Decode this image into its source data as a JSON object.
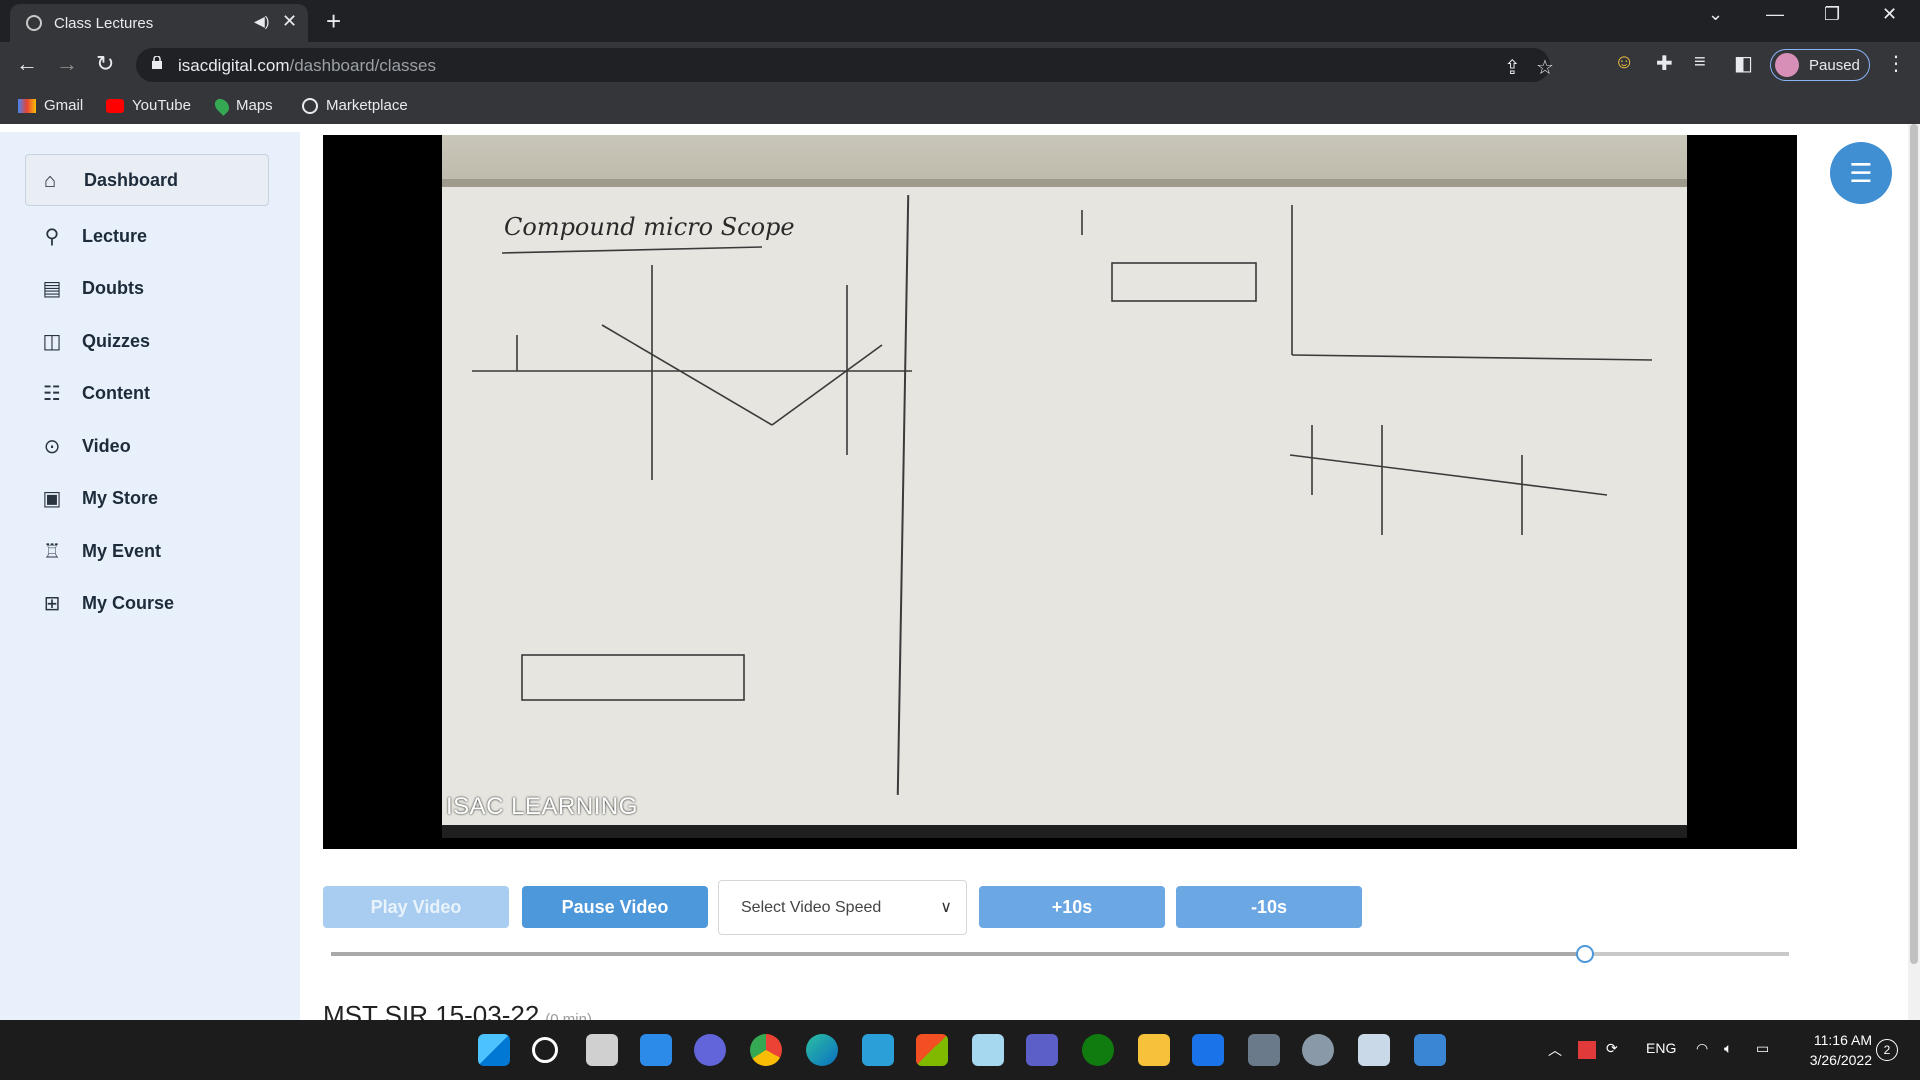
{
  "browser": {
    "tab_title": "Class Lectures",
    "url_host": "isacdigital.com",
    "url_path": "/dashboard/classes",
    "profile_label": "Paused",
    "bookmarks": [
      "Gmail",
      "YouTube",
      "Maps",
      "Marketplace"
    ]
  },
  "sidebar": {
    "dashboard_label": "Dashboard",
    "items": [
      {
        "label": "Lecture",
        "icon": "lecture-icon"
      },
      {
        "label": "Doubts",
        "icon": "document-icon"
      },
      {
        "label": "Quizzes",
        "icon": "book-icon"
      },
      {
        "label": "Content",
        "icon": "list-icon"
      },
      {
        "label": "Video",
        "icon": "play-circle-icon"
      },
      {
        "label": "My Store",
        "icon": "store-icon"
      },
      {
        "label": "My Event",
        "icon": "trophy-icon"
      },
      {
        "label": "My Course",
        "icon": "grid-icon"
      }
    ]
  },
  "video": {
    "watermark": "ISAC LEARNING",
    "board_title": "Compound micro Scope",
    "progress_fraction": 0.86
  },
  "controls": {
    "play_label": "Play Video",
    "pause_label": "Pause Video",
    "speed_placeholder": "Select Video Speed",
    "forward_label": "+10s",
    "back_label": "-10s"
  },
  "lecture": {
    "title": "MST SIR 15-03-22",
    "duration": "(0 min)"
  },
  "taskbar": {
    "language": "ENG",
    "time": "11:16 AM",
    "date": "3/26/2022",
    "notification_count": "2"
  }
}
